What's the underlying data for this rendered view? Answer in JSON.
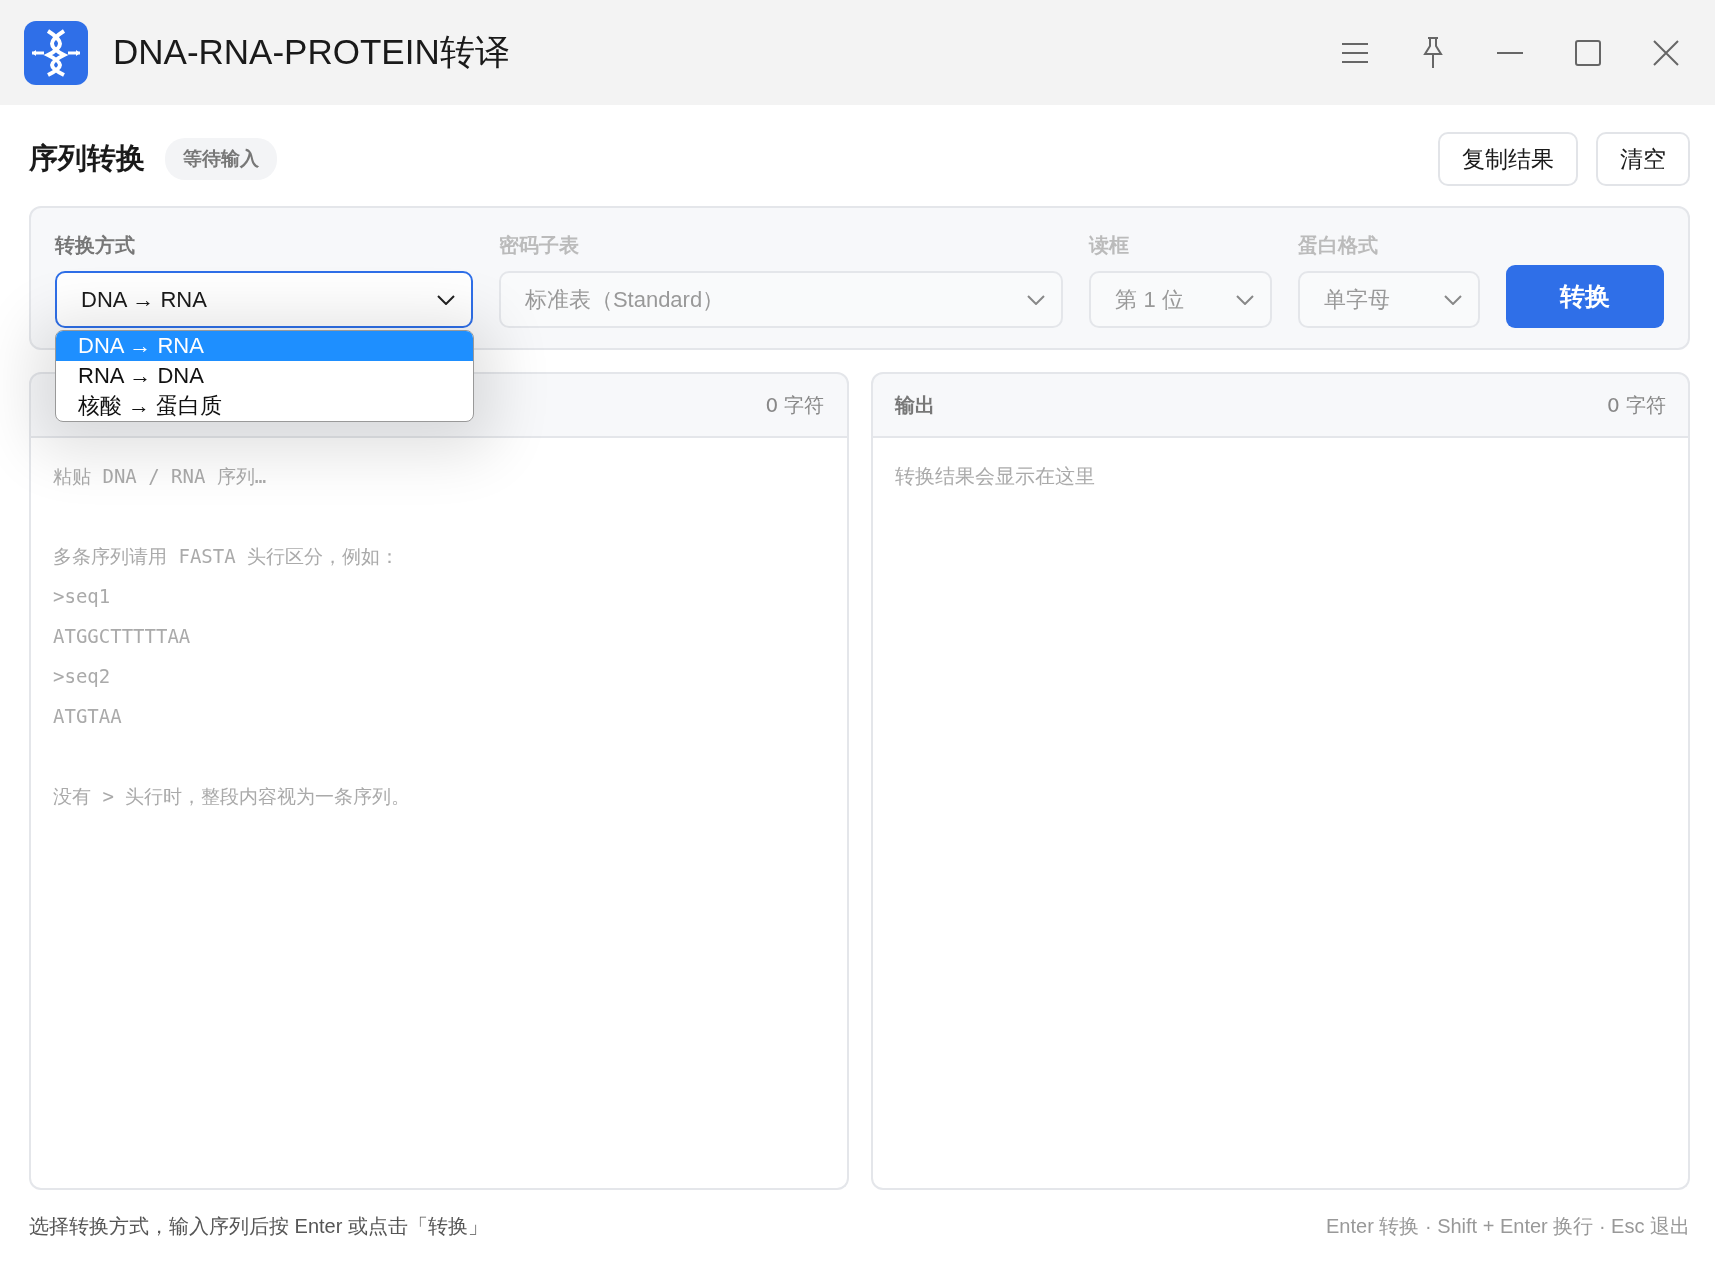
{
  "window": {
    "title": "DNA-RNA-PROTEIN转译"
  },
  "header": {
    "title": "序列转换",
    "status": "等待输入",
    "buttons": [
      "复制结果",
      "清空"
    ]
  },
  "controls": [
    {
      "label": "转换方式",
      "value": "DNA → RNA",
      "focused": true,
      "disabled": false
    },
    {
      "label": "密码子表",
      "value": "标准表（Standard）",
      "focused": false,
      "disabled": true
    },
    {
      "label": "读框",
      "value": "第 1 位",
      "focused": false,
      "disabled": true
    },
    {
      "label": "蛋白格式",
      "value": "单字母",
      "focused": false,
      "disabled": true
    }
  ],
  "convert_button": "转换",
  "dropdown": {
    "options": [
      {
        "label": "DNA → RNA",
        "selected": true
      },
      {
        "label": "RNA → DNA",
        "selected": false
      },
      {
        "label": "核酸 → 蛋白质",
        "selected": false
      }
    ]
  },
  "input_panel": {
    "count": "0 字符",
    "placeholder": "粘贴 DNA / RNA 序列…\n\n多条序列请用 FASTA 头行区分，例如：\n>seq1\nATGGCTTTTTAA\n>seq2\nATGTAA\n\n没有 > 头行时，整段内容视为一条序列。"
  },
  "output_panel": {
    "title": "输出",
    "count": "0 字符",
    "placeholder": "转换结果会显示在这里"
  },
  "status_bar": {
    "hint": "选择转换方式，输入序列后按 Enter 或点击「转换」",
    "shortcuts": "Enter 转换 · Shift + Enter 换行 · Esc 退出"
  }
}
